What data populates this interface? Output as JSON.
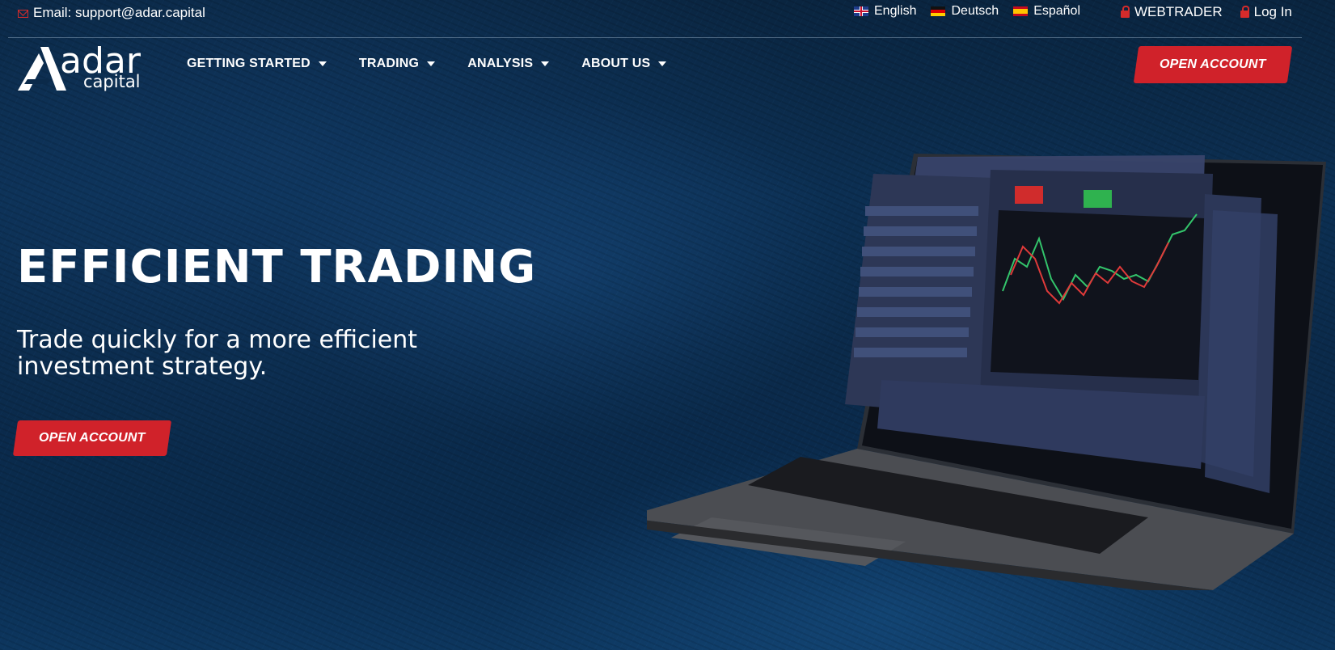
{
  "topbar": {
    "email_label": "Email: support@adar.capital",
    "languages": [
      {
        "label": "English",
        "flag": "uk-flag-icon"
      },
      {
        "label": "Deutsch",
        "flag": "germany-flag-icon"
      },
      {
        "label": "Español",
        "flag": "spain-flag-icon"
      }
    ],
    "webtrader_label": "WEBTRADER",
    "login_label": "Log In"
  },
  "logo": {
    "word1": "adar",
    "word2": "capital"
  },
  "nav": {
    "items": [
      {
        "label": "GETTING STARTED"
      },
      {
        "label": "TRADING"
      },
      {
        "label": "ANALYSIS"
      },
      {
        "label": "ABOUT US"
      }
    ],
    "open_account_label": "OPEN ACCOUNT"
  },
  "hero": {
    "title": "EFFICIENT TRADING",
    "subtitle": "Trade quickly for a more efficient investment strategy.",
    "cta_label": "OPEN ACCOUNT"
  },
  "colors": {
    "accent": "#d0222a",
    "background": "#0b2a4a",
    "text": "#ffffff"
  }
}
